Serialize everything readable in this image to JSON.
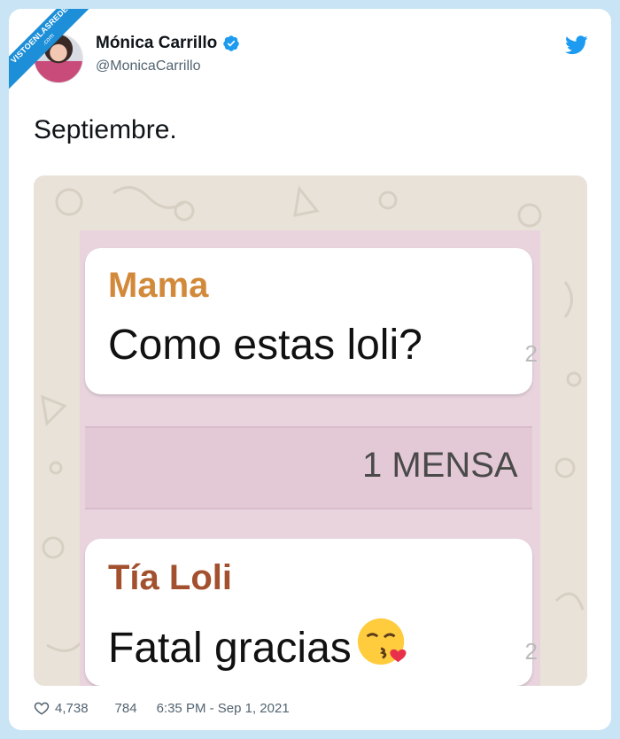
{
  "ribbon": {
    "line1": "VISTOENLASREDES",
    "line2": ".com"
  },
  "tweet": {
    "author_name": "Mónica Carrillo",
    "author_handle": "@MonicaCarrillo",
    "text": "Septiembre.",
    "likes": "4,738",
    "retweets": "784",
    "timestamp": "6:35 PM - Sep 1, 2021"
  },
  "chat": {
    "messages": [
      {
        "sender": "Mama",
        "text": "Como estas loli?",
        "time_fragment": "2"
      },
      {
        "sender": "Tía Loli",
        "text": "Fatal gracias",
        "time_fragment": "2",
        "emoji": "face-blowing-kiss"
      }
    ],
    "unread_banner": "1 MENSA"
  },
  "colors": {
    "verified": "#1d9bf0",
    "twitter_bird": "#1d9bf0",
    "sender_mama": "#d28a3a",
    "sender_tia": "#a3502f",
    "ribbon": "#1d8fd8"
  },
  "icons": [
    "verified-icon",
    "twitter-bird-icon",
    "heart-icon",
    "kiss-emoji-icon"
  ]
}
